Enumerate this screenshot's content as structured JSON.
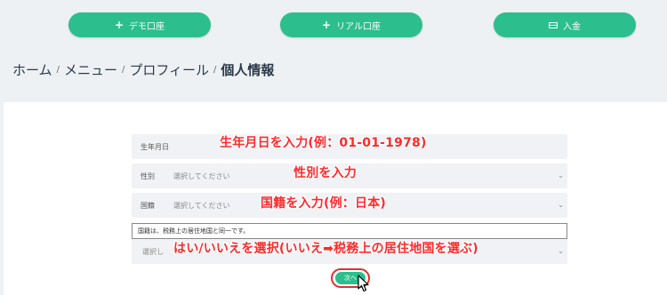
{
  "top_buttons": {
    "demo": {
      "icon": "plus-icon",
      "label": "デモ口座"
    },
    "real": {
      "icon": "plus-icon",
      "label": "リアル口座"
    },
    "deposit": {
      "icon": "credit-card-icon",
      "label": "入金"
    }
  },
  "breadcrumb": {
    "items": [
      "ホーム",
      "メニュー",
      "プロフィール"
    ],
    "current": "個人情報",
    "separator": "/"
  },
  "form": {
    "birth_label": "生年月日",
    "gender_label": "性別",
    "gender_placeholder": "選択してください",
    "nationality_label": "国籍",
    "nationality_placeholder": "選択してください",
    "tax_note": "国籍は、税務上の居住地国と同一です。",
    "tax_select_placeholder": "選択し",
    "next_label": "次へ"
  },
  "annotations": {
    "birth": "生年月日を入力(例：01-01-1978)",
    "gender": "性別を入力",
    "nationality": "国籍を入力(例：日本)",
    "tax": "はい/いいえを選択(いいえ➡税務上の居住地国を選ぶ)"
  },
  "colors": {
    "accent_green": "#2dbe8e",
    "annotation_red": "#ff2a2a",
    "highlight_border": "#e23030"
  }
}
